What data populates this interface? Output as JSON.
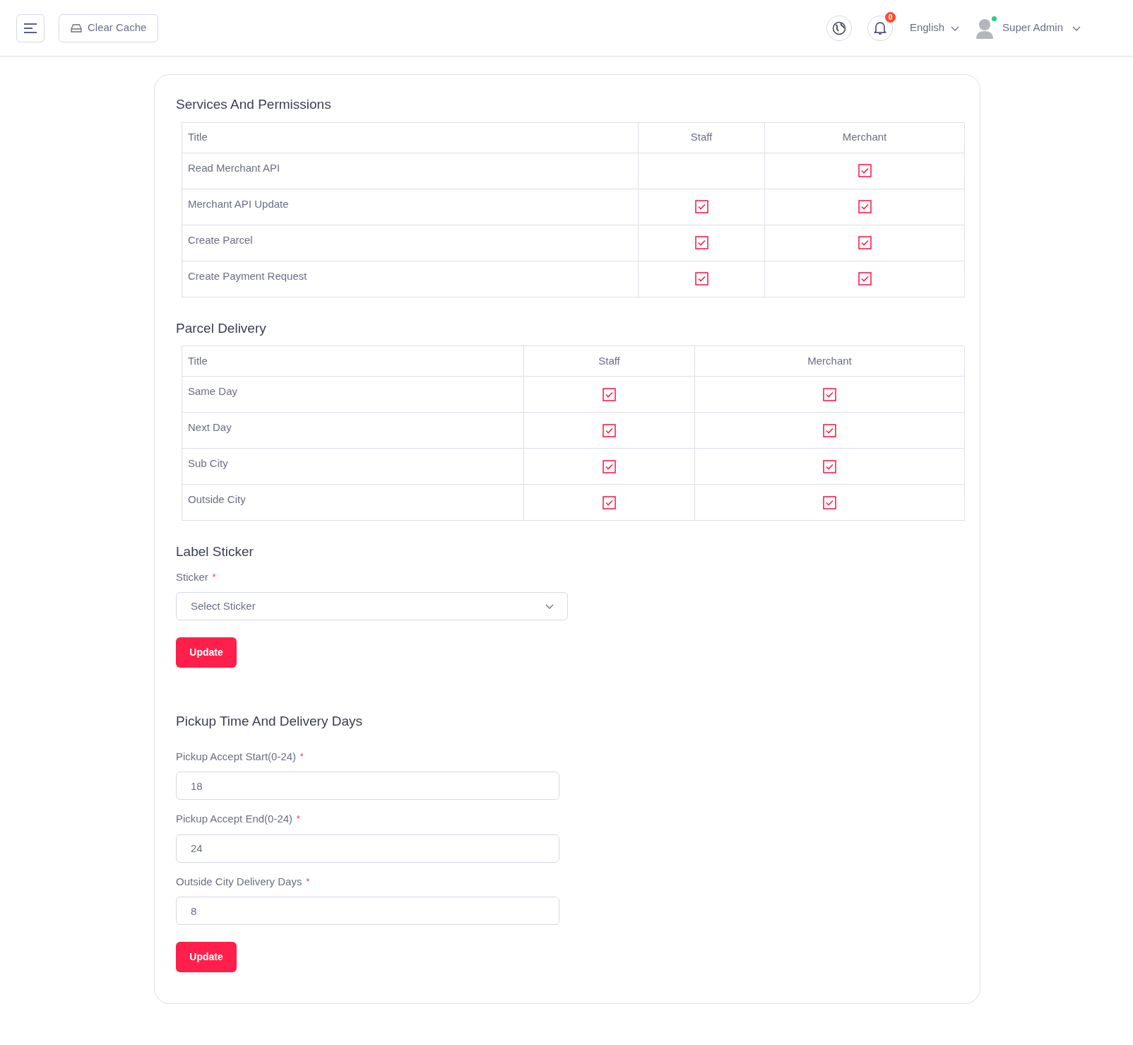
{
  "header": {
    "clear_cache": "Clear Cache",
    "notification_count": "0",
    "language": "English",
    "user": "Super Admin",
    "user_online": true
  },
  "permission_tables": [
    {
      "title": "Services And Permissions",
      "columns": [
        "Title",
        "Staff",
        "Merchant"
      ],
      "rows": [
        {
          "title": "Read Merchant API",
          "staff": false,
          "merchant": true
        },
        {
          "title": "Merchant API Update",
          "staff": true,
          "merchant": true
        },
        {
          "title": "Create Parcel",
          "staff": true,
          "merchant": true
        },
        {
          "title": "Create Payment Request",
          "staff": true,
          "merchant": true
        }
      ]
    },
    {
      "title": "Parcel Delivery",
      "columns": [
        "Title",
        "Staff",
        "Merchant"
      ],
      "rows": [
        {
          "title": "Same Day",
          "staff": true,
          "merchant": true
        },
        {
          "title": "Next Day",
          "staff": true,
          "merchant": true
        },
        {
          "title": "Sub City",
          "staff": true,
          "merchant": true
        },
        {
          "title": "Outside City",
          "staff": true,
          "merchant": true
        }
      ]
    }
  ],
  "label_sticker": {
    "title": "Label Sticker",
    "label": "Sticker",
    "required": "*",
    "placeholder": "Select Sticker",
    "button": "Update"
  },
  "pickup": {
    "title": "Pickup Time And Delivery Days",
    "fields": [
      {
        "label": "Pickup Accept Start(0-24)",
        "required": "*",
        "value": "18"
      },
      {
        "label": "Pickup Accept End(0-24)",
        "required": "*",
        "value": "24"
      },
      {
        "label": "Outside City Delivery Days",
        "required": "*",
        "value": "8"
      }
    ],
    "button": "Update"
  }
}
